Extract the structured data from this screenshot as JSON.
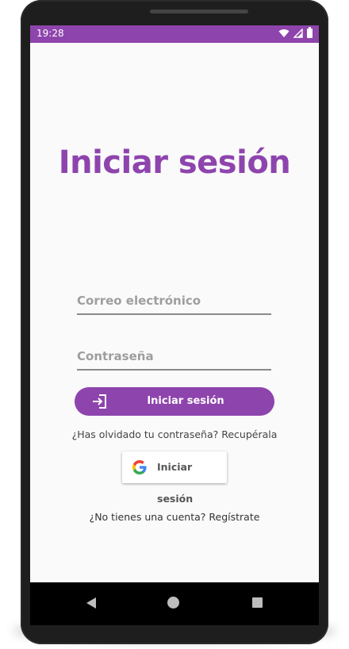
{
  "status_bar": {
    "time": "19:28",
    "icons": [
      "wifi-icon",
      "signal-icon",
      "battery-icon"
    ]
  },
  "login": {
    "title": "Iniciar sesión",
    "email_placeholder": "Correo electrónico",
    "email_value": "",
    "password_placeholder": "Contraseña",
    "password_value": "",
    "submit_label": "Iniciar sesión",
    "submit_icon": "login-icon",
    "forgot_text": "¿Has olvidado tu contraseña? Recupérala",
    "google_label": "Iniciar sesión",
    "google_icon": "google-icon",
    "signup_text": "¿No tienes una cuenta? Regístrate"
  },
  "navigation": {
    "buttons": [
      "back-icon",
      "home-icon",
      "recents-icon"
    ]
  },
  "colors": {
    "accent": "#8e44ad",
    "status_bar": "#8e44ad",
    "screen_background": "#fafafa",
    "nav_bar": "#000000"
  }
}
